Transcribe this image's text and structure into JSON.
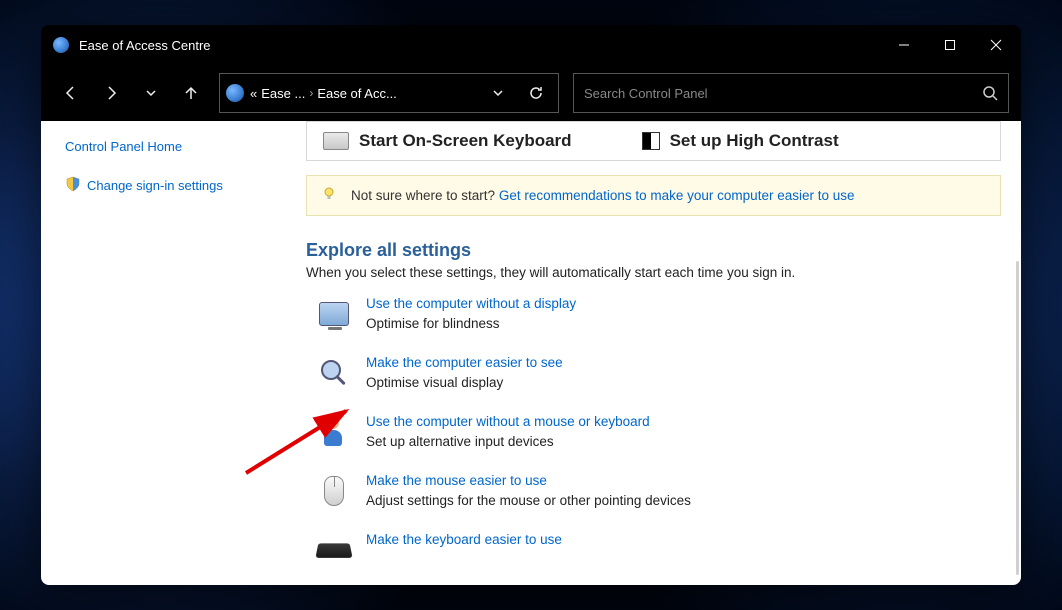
{
  "window": {
    "title": "Ease of Access Centre"
  },
  "breadcrumbs": {
    "seg0": "«",
    "seg1": "Ease ...",
    "seg2": "Ease of Acc..."
  },
  "search": {
    "placeholder": "Search Control Panel"
  },
  "sidebar": {
    "home": "Control Panel Home",
    "signin": "Change sign-in settings"
  },
  "quick_access": {
    "osk": "Start On-Screen Keyboard",
    "contrast": "Set up High Contrast"
  },
  "info_bar": {
    "lead": "Not sure where to start? ",
    "link": "Get recommendations to make your computer easier to use"
  },
  "section": {
    "heading": "Explore all settings",
    "sub": "When you select these settings, they will automatically start each time you sign in."
  },
  "settings": [
    {
      "link": "Use the computer without a display",
      "desc": "Optimise for blindness"
    },
    {
      "link": "Make the computer easier to see",
      "desc": "Optimise visual display"
    },
    {
      "link": "Use the computer without a mouse or keyboard",
      "desc": "Set up alternative input devices"
    },
    {
      "link": "Make the mouse easier to use",
      "desc": "Adjust settings for the mouse or other pointing devices"
    },
    {
      "link": "Make the keyboard easier to use",
      "desc": ""
    }
  ]
}
